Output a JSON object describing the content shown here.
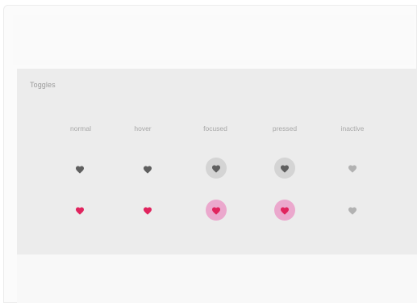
{
  "section": {
    "title": "Toggles"
  },
  "columns": [
    {
      "label": "normal"
    },
    {
      "label": "hover"
    },
    {
      "label": "focused"
    },
    {
      "label": "pressed"
    },
    {
      "label": "inactive"
    }
  ],
  "icons": {
    "toggle": "heart-icon"
  },
  "colors": {
    "off_heart": "#5f5f5f",
    "on_heart": "#e0245e",
    "inactive_heart": "#b2b2b2",
    "focus_halo_off": "#d4d4d4",
    "focus_halo_on": "#eba8cd",
    "panel_bg": "#ececec"
  },
  "rows": [
    {
      "state": "off",
      "cells": [
        "normal",
        "hover",
        "focused",
        "pressed",
        "inactive"
      ]
    },
    {
      "state": "on",
      "cells": [
        "normal",
        "hover",
        "focused",
        "pressed",
        "inactive"
      ]
    }
  ]
}
